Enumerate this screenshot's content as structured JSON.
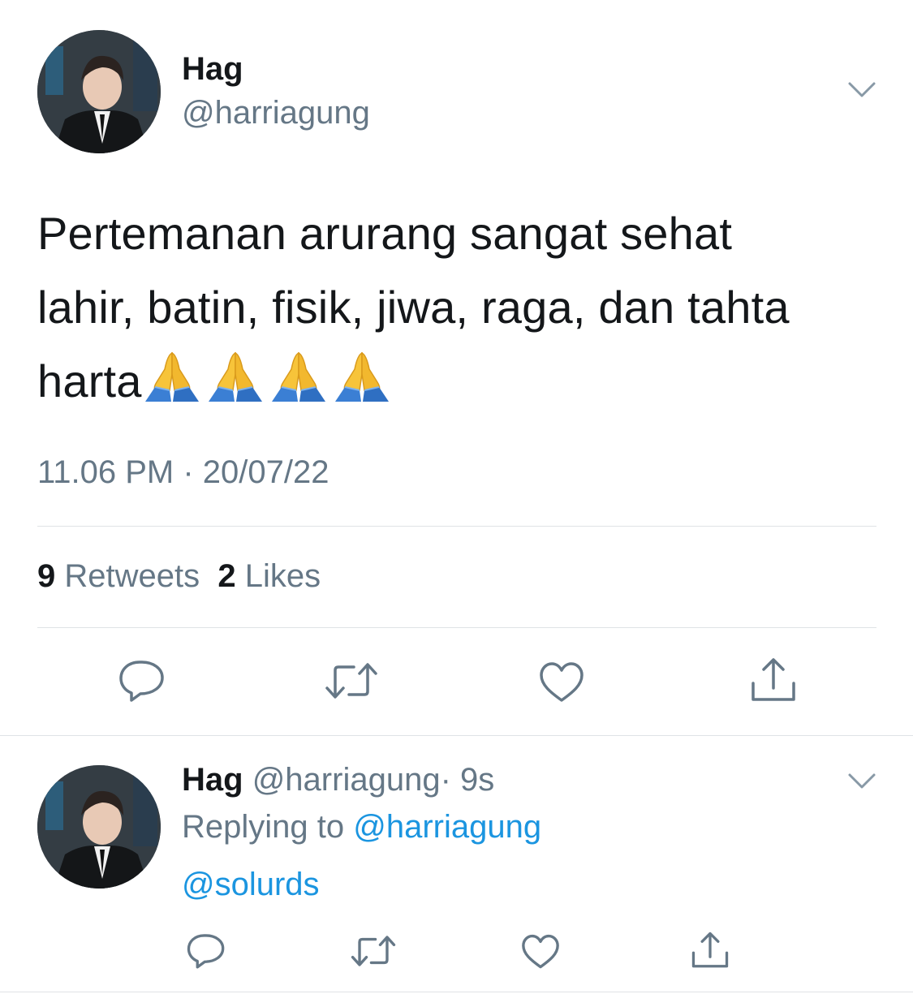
{
  "tweet": {
    "author_name": "Hag",
    "author_handle": "@harriagung",
    "text_lines": [
      "Pertemanan arurang sangat sehat",
      "lahir, batin, fisik, jiwa, raga, dan tahta",
      "harta"
    ],
    "emoji": "🙏🙏🙏🙏",
    "timestamp": "11.06 PM · 20/07/22",
    "retweets_count": "9",
    "retweets_label": "Retweets",
    "likes_count": "2",
    "likes_label": "Likes"
  },
  "reply": {
    "author_name": "Hag",
    "author_handle": "@harriagung",
    "time": "· 9s",
    "replying_to_label": "Replying to",
    "replying_to_handle": "@harriagung",
    "text": "@solurds"
  },
  "icons": {
    "action_bar": [
      "reply-icon",
      "retweet-icon",
      "like-icon",
      "share-icon"
    ],
    "menu": "chevron-down-icon"
  },
  "colors": {
    "text": "#14171a",
    "secondary": "#657786",
    "link": "#1b95e0",
    "divider": "#dfe3e6"
  }
}
